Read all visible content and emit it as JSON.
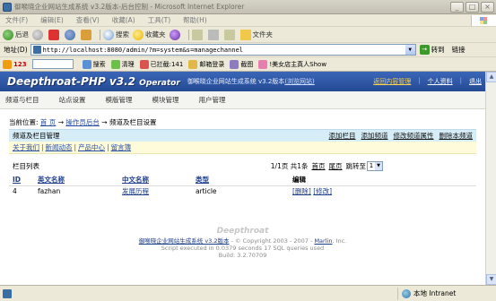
{
  "window": {
    "title": "御喉晓企业网站生成系统 v3.2版本-后台控制 - Microsoft Internet Explorer",
    "minimize": "_",
    "maximize": "□",
    "close": "×"
  },
  "menu": [
    "文件(F)",
    "编辑(E)",
    "查看(V)",
    "收藏(A)",
    "工具(T)",
    "帮助(H)"
  ],
  "toolbar": {
    "back": "后退",
    "search": "搜索",
    "favorites": "收藏夹",
    "folder": "文件夹"
  },
  "address": {
    "label": "地址(D)",
    "url": "http://localhost:8080/admin/?m=system&s=managechannel",
    "go": "转到",
    "links": "链接"
  },
  "toolbar2": {
    "brand": "123",
    "search": "搜索",
    "clean": "清理",
    "blocked": "已拦截:141",
    "mail": "邮箱登录",
    "capture": "截图",
    "ad": "!美女店主真人Show"
  },
  "app": {
    "brand": "Deepthroat-PHP v3.2",
    "brand_sub": "Operator",
    "subtitle": "御喉晓企业网站生成系统 v3.2版本",
    "home_link": "(浏览网站)",
    "header_links": [
      "返回内容管理",
      "个人资料",
      "退出"
    ],
    "nav": [
      "频道与栏目",
      "站点设置",
      "模版管理",
      "模块管理",
      "用户管理"
    ],
    "breadcrumb": {
      "prefix": "当前位置:",
      "home": "首 页",
      "arrow1": "→",
      "admin": "操作员后台",
      "arrow2": "→",
      "current": "频道及栏目设置"
    },
    "panel": {
      "title": "频道及栏目管理",
      "actions": [
        "添加栏目",
        "添加频道",
        "修改频道属性",
        "删除本频道"
      ],
      "channels": [
        "关于我们",
        "新闻动态",
        "产品中心",
        "留言簿"
      ],
      "list_title": "栏目列表",
      "pager": {
        "info": "1/1页 共1条",
        "first": "首页",
        "last": "尾页",
        "jump": "跳转至",
        "page": "1"
      },
      "columns": [
        "ID",
        "英文名称",
        "中文名称",
        "类型",
        "编辑"
      ],
      "rows": [
        {
          "id": "4",
          "en": "fazhan",
          "cn": "发展历程",
          "type": "article",
          "delete": "[删除]",
          "edit": "[修改]"
        }
      ]
    },
    "footer": {
      "brand": "Deepthroat",
      "system_link": "御喉晓企业网站生成系统 v3.2版本",
      "copyright": "- © Copyright 2003 - 2007 -",
      "author": "Marlin",
      "author_suffix": ". Inc.",
      "stats": "Script executed in 0.0379 seconds 17 SQL queries used",
      "build": "Build: 3.2.70709"
    }
  },
  "status": {
    "zone": "本地 Intranet"
  }
}
